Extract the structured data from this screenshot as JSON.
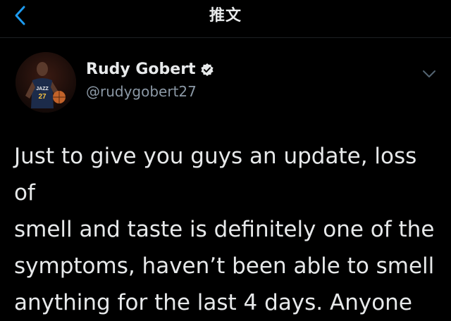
{
  "header": {
    "title": "推文",
    "back_icon": "chevron-left-icon",
    "accent_color": "#1d9bf0"
  },
  "author": {
    "display_name": "Rudy Gobert",
    "handle": "@rudygobert27",
    "verified": true,
    "avatar_jersey_number": "27",
    "avatar_jersey_text": "JAZZ"
  },
  "tweet": {
    "text": "Just to give you guys an update, loss of\nsmell and taste is definitely one of the\nsymptoms, haven’t been able to smell\nanything for the last 4 days. Anyone"
  },
  "icons": {
    "more": "chevron-down-icon",
    "verified": "verified-badge-icon"
  }
}
